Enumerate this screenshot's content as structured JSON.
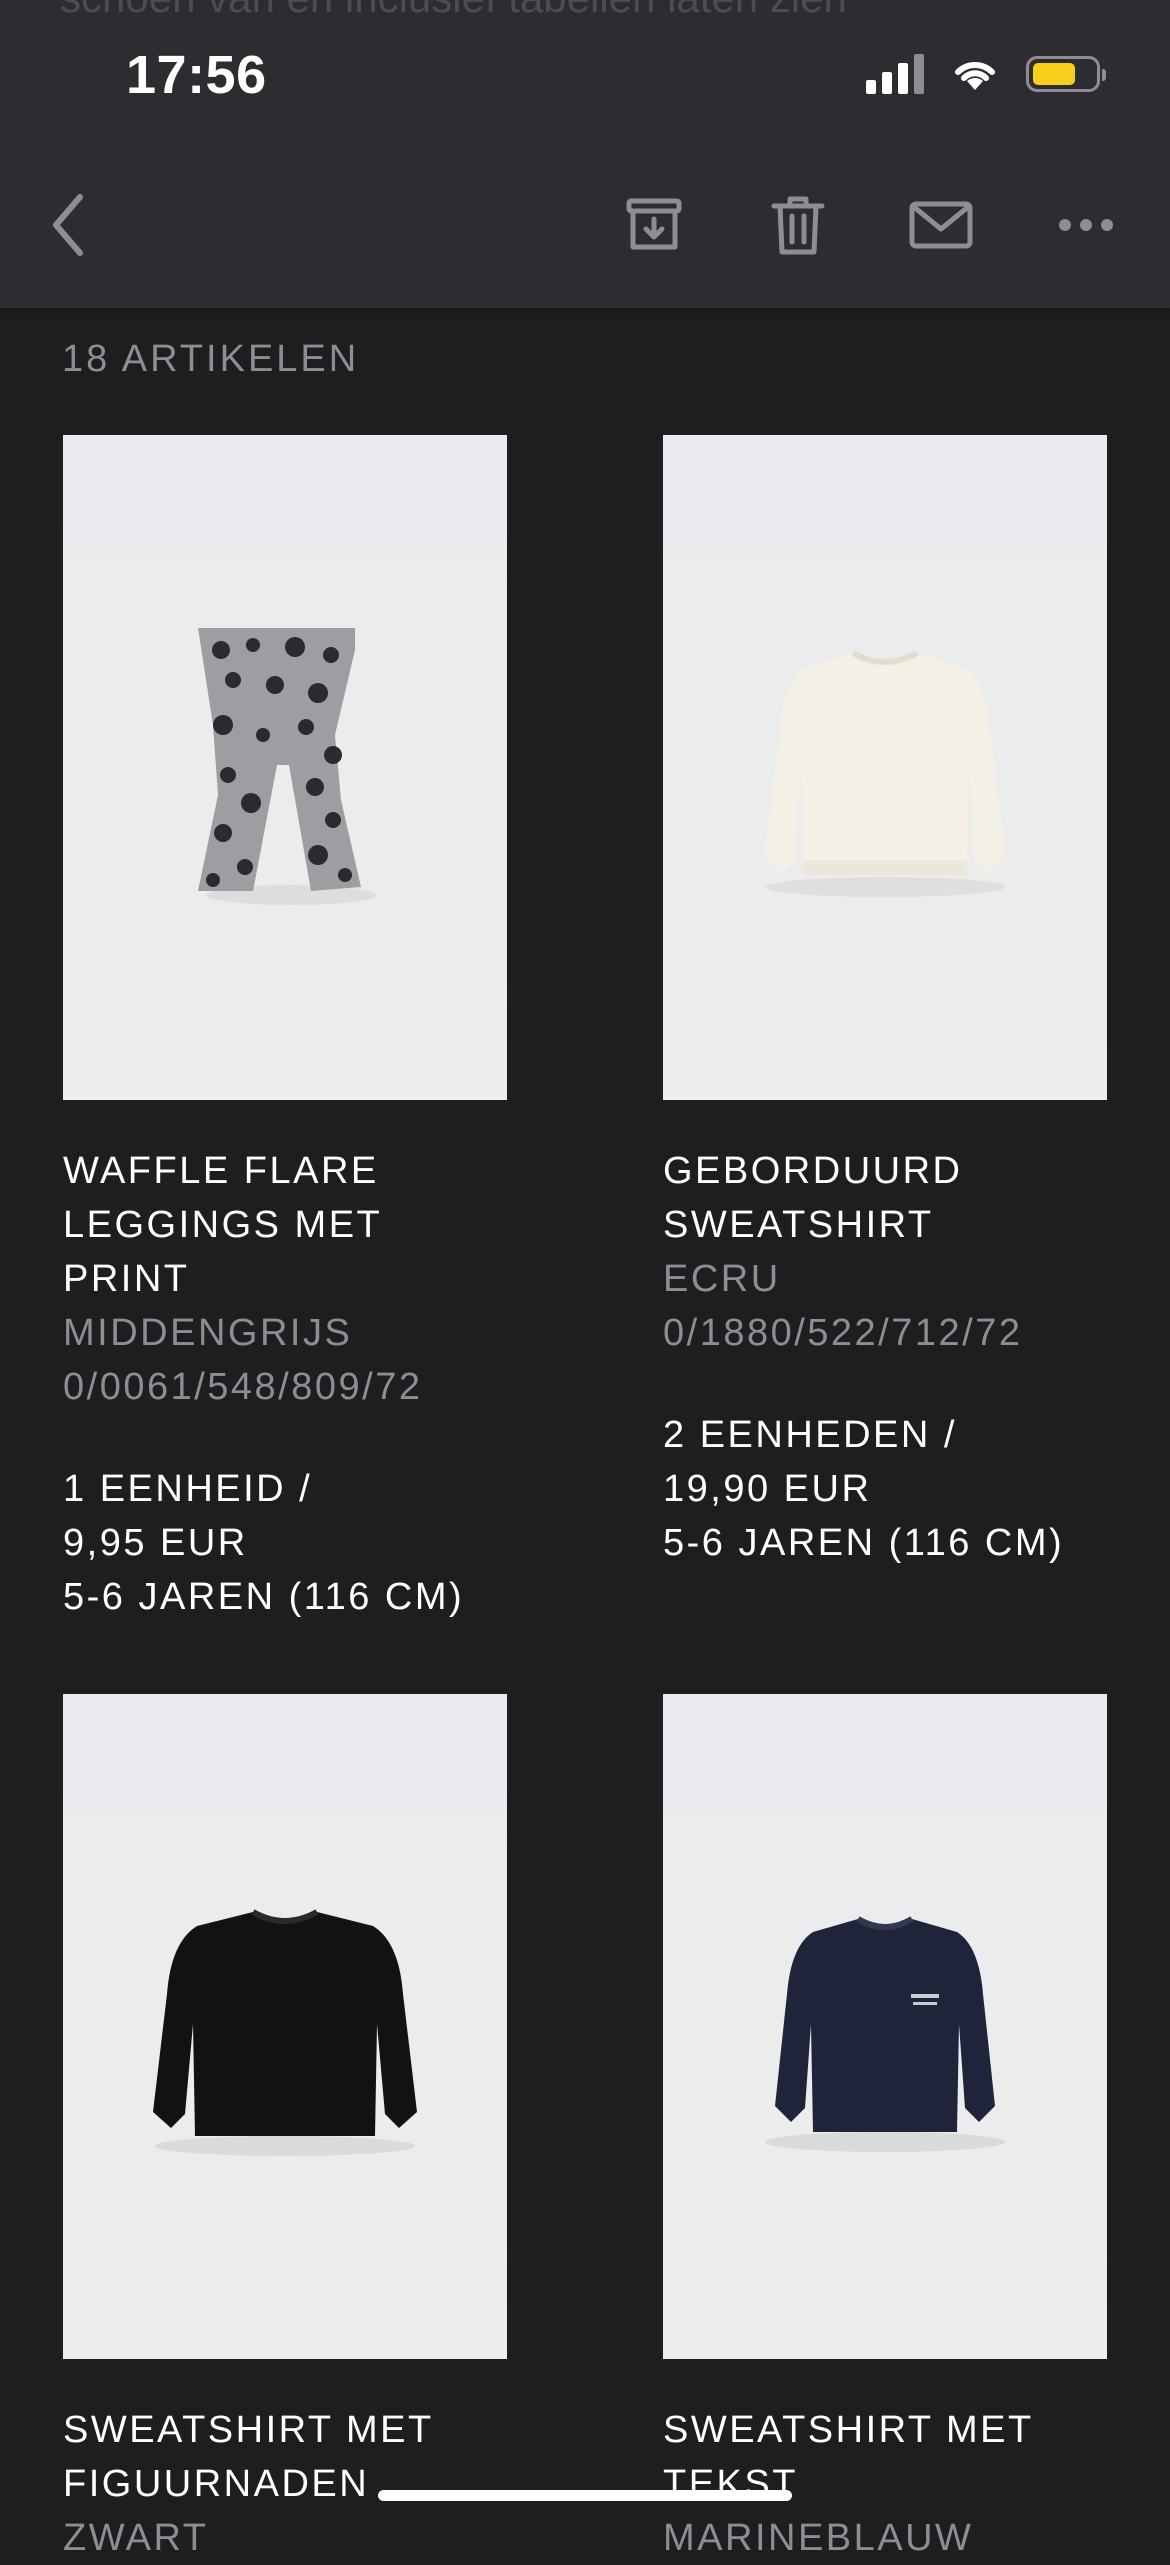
{
  "status_bar": {
    "time": "17:56"
  },
  "email_preview_snippet": "schoen van en inclusief tabellen laten zien",
  "toolbar": {
    "back": "chevron-left-icon",
    "archive": "archive-box-icon",
    "delete": "trash-icon",
    "reply": "envelope-icon",
    "more": "ellipsis-icon"
  },
  "order": {
    "count_label": "18 ARTIKELEN",
    "items": [
      {
        "name_lines": [
          "WAFFLE FLARE",
          "LEGGINGS MET",
          "PRINT"
        ],
        "color": "MIDDENGRIJS",
        "reference": "0/0061/548/809/72",
        "quantity": "1 EENHEID /",
        "price": "9,95 EUR",
        "size": "5-6 JAREN (116 CM)",
        "image": "grey-leopard-flare-leggings"
      },
      {
        "name_lines": [
          "GEBORDUURD",
          "SWEATSHIRT"
        ],
        "color": "ECRU",
        "reference": "0/1880/522/712/72",
        "quantity": "2 EENHEDEN /",
        "price": "19,90 EUR",
        "size": "5-6 JAREN (116 CM)",
        "image": "ecru-sweatshirt"
      },
      {
        "name_lines": [
          "SWEATSHIRT MET",
          "FIGUURNADEN"
        ],
        "color": "ZWART",
        "image": "black-sweatshirt"
      },
      {
        "name_lines": [
          "SWEATSHIRT MET",
          "TEKST"
        ],
        "color": "MARINEBLAUW",
        "image": "navy-text-sweatshirt"
      }
    ]
  },
  "colors": {
    "background": "#1e1e21",
    "toolbar": "#2d2c31",
    "muted_text": "#8e8d93",
    "battery": "#f5cf1a"
  }
}
